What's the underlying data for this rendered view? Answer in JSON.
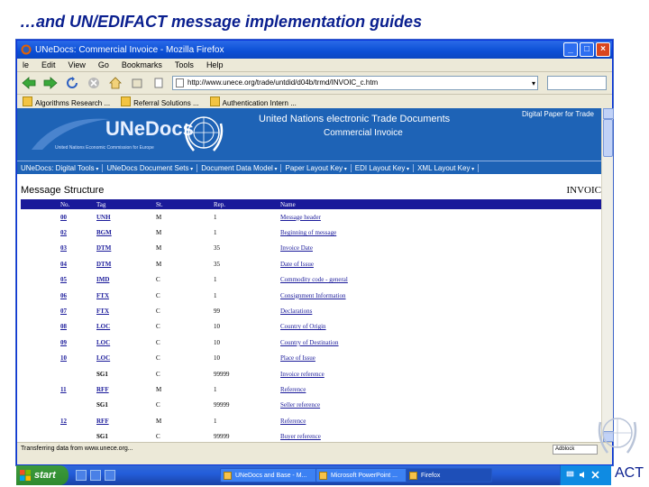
{
  "slide": {
    "title": "…and UN/EDIFACT message implementation guides",
    "right_text": "ACT"
  },
  "window": {
    "title": "UNeDocs: Commercial Invoice - Mozilla Firefox",
    "menu": [
      "le",
      "Edit",
      "View",
      "Go",
      "Bookmarks",
      "Tools",
      "Help"
    ],
    "url": "http://www.unece.org/trade/untdid/d04b/trmd/INVOIC_c.htm",
    "bookmarks": [
      "Algorithms Research ...",
      "Referral Solutions ...",
      "Authentication Intern ..."
    ],
    "status": "Transferring data from www.unece.org...",
    "status_right": "Adblock"
  },
  "page": {
    "brand": "UNeDocs",
    "brand_sub": "United Nations Economic Commission for Europe",
    "heading1": "United Nations electronic Trade Documents",
    "heading2": "Commercial Invoice",
    "tagline": "Digital Paper for Trade",
    "nav": [
      "UNeDocs: Digital Tools",
      "UNeDocs Document Sets",
      "Document Data Model",
      "Paper Layout Key",
      "EDI Layout Key",
      "XML Layout Key"
    ],
    "message_structure_label": "Message Structure",
    "message_code": "INVOIC",
    "columns": [
      "No.",
      "Tag",
      "St.",
      "Rep.",
      "Name"
    ],
    "rows": [
      {
        "no": "00",
        "tag": "UNH",
        "st": "M",
        "rep": "1",
        "name": "Message header"
      },
      {
        "no": "02",
        "tag": "BGM",
        "st": "M",
        "rep": "1",
        "name": "Beginning of message"
      },
      {
        "no": "03",
        "tag": "DTM",
        "st": "M",
        "rep": "35",
        "name": "Invoice Date"
      },
      {
        "no": "04",
        "tag": "DTM",
        "st": "M",
        "rep": "35",
        "name": "Date of Issue"
      },
      {
        "no": "05",
        "tag": "IMD",
        "st": "C",
        "rep": "1",
        "name": "Commodity code - general"
      },
      {
        "no": "06",
        "tag": "FTX",
        "st": "C",
        "rep": "1",
        "name": "Consignment Information"
      },
      {
        "no": "07",
        "tag": "FTX",
        "st": "C",
        "rep": "99",
        "name": "Declarations"
      },
      {
        "no": "08",
        "tag": "LOC",
        "st": "C",
        "rep": "10",
        "name": "Country of Origin"
      },
      {
        "no": "09",
        "tag": "LOC",
        "st": "C",
        "rep": "10",
        "name": "Country of Destination"
      },
      {
        "no": "10",
        "tag": "LOC",
        "st": "C",
        "rep": "10",
        "name": "Place of Issue"
      },
      {
        "no": "",
        "tag": "SG1",
        "st": "C",
        "rep": "99999",
        "name": "Invoice reference"
      },
      {
        "no": "11",
        "tag": "RFF",
        "st": "M",
        "rep": "1",
        "name": "Reference"
      },
      {
        "no": "",
        "tag": "SG1",
        "st": "C",
        "rep": "99999",
        "name": "Seller reference"
      },
      {
        "no": "12",
        "tag": "RFF",
        "st": "M",
        "rep": "1",
        "name": "Reference"
      },
      {
        "no": "",
        "tag": "SG1",
        "st": "C",
        "rep": "99999",
        "name": "Buyer reference"
      }
    ]
  },
  "taskbar": {
    "start_label": "start",
    "items": [
      "UNeDocs and Base - M...",
      "Microsoft PowerPoint ...",
      "Firefox"
    ]
  },
  "colors": {
    "slide_title": "#0a1f8f",
    "banner": "#1e63b6",
    "table_header": "#1a1a9a",
    "link": "#1a1a9a"
  }
}
